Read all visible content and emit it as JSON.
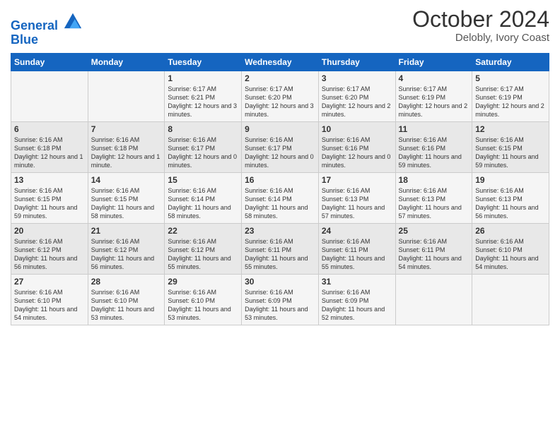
{
  "logo": {
    "line1": "General",
    "line2": "Blue"
  },
  "title": "October 2024",
  "location": "Delobly, Ivory Coast",
  "days_header": [
    "Sunday",
    "Monday",
    "Tuesday",
    "Wednesday",
    "Thursday",
    "Friday",
    "Saturday"
  ],
  "weeks": [
    [
      {
        "day": "",
        "content": ""
      },
      {
        "day": "",
        "content": ""
      },
      {
        "day": "1",
        "content": "Sunrise: 6:17 AM\nSunset: 6:21 PM\nDaylight: 12 hours and 3 minutes."
      },
      {
        "day": "2",
        "content": "Sunrise: 6:17 AM\nSunset: 6:20 PM\nDaylight: 12 hours and 3 minutes."
      },
      {
        "day": "3",
        "content": "Sunrise: 6:17 AM\nSunset: 6:20 PM\nDaylight: 12 hours and 2 minutes."
      },
      {
        "day": "4",
        "content": "Sunrise: 6:17 AM\nSunset: 6:19 PM\nDaylight: 12 hours and 2 minutes."
      },
      {
        "day": "5",
        "content": "Sunrise: 6:17 AM\nSunset: 6:19 PM\nDaylight: 12 hours and 2 minutes."
      }
    ],
    [
      {
        "day": "6",
        "content": "Sunrise: 6:16 AM\nSunset: 6:18 PM\nDaylight: 12 hours and 1 minute."
      },
      {
        "day": "7",
        "content": "Sunrise: 6:16 AM\nSunset: 6:18 PM\nDaylight: 12 hours and 1 minute."
      },
      {
        "day": "8",
        "content": "Sunrise: 6:16 AM\nSunset: 6:17 PM\nDaylight: 12 hours and 0 minutes."
      },
      {
        "day": "9",
        "content": "Sunrise: 6:16 AM\nSunset: 6:17 PM\nDaylight: 12 hours and 0 minutes."
      },
      {
        "day": "10",
        "content": "Sunrise: 6:16 AM\nSunset: 6:16 PM\nDaylight: 12 hours and 0 minutes."
      },
      {
        "day": "11",
        "content": "Sunrise: 6:16 AM\nSunset: 6:16 PM\nDaylight: 11 hours and 59 minutes."
      },
      {
        "day": "12",
        "content": "Sunrise: 6:16 AM\nSunset: 6:15 PM\nDaylight: 11 hours and 59 minutes."
      }
    ],
    [
      {
        "day": "13",
        "content": "Sunrise: 6:16 AM\nSunset: 6:15 PM\nDaylight: 11 hours and 59 minutes."
      },
      {
        "day": "14",
        "content": "Sunrise: 6:16 AM\nSunset: 6:15 PM\nDaylight: 11 hours and 58 minutes."
      },
      {
        "day": "15",
        "content": "Sunrise: 6:16 AM\nSunset: 6:14 PM\nDaylight: 11 hours and 58 minutes."
      },
      {
        "day": "16",
        "content": "Sunrise: 6:16 AM\nSunset: 6:14 PM\nDaylight: 11 hours and 58 minutes."
      },
      {
        "day": "17",
        "content": "Sunrise: 6:16 AM\nSunset: 6:13 PM\nDaylight: 11 hours and 57 minutes."
      },
      {
        "day": "18",
        "content": "Sunrise: 6:16 AM\nSunset: 6:13 PM\nDaylight: 11 hours and 57 minutes."
      },
      {
        "day": "19",
        "content": "Sunrise: 6:16 AM\nSunset: 6:13 PM\nDaylight: 11 hours and 56 minutes."
      }
    ],
    [
      {
        "day": "20",
        "content": "Sunrise: 6:16 AM\nSunset: 6:12 PM\nDaylight: 11 hours and 56 minutes."
      },
      {
        "day": "21",
        "content": "Sunrise: 6:16 AM\nSunset: 6:12 PM\nDaylight: 11 hours and 56 minutes."
      },
      {
        "day": "22",
        "content": "Sunrise: 6:16 AM\nSunset: 6:12 PM\nDaylight: 11 hours and 55 minutes."
      },
      {
        "day": "23",
        "content": "Sunrise: 6:16 AM\nSunset: 6:11 PM\nDaylight: 11 hours and 55 minutes."
      },
      {
        "day": "24",
        "content": "Sunrise: 6:16 AM\nSunset: 6:11 PM\nDaylight: 11 hours and 55 minutes."
      },
      {
        "day": "25",
        "content": "Sunrise: 6:16 AM\nSunset: 6:11 PM\nDaylight: 11 hours and 54 minutes."
      },
      {
        "day": "26",
        "content": "Sunrise: 6:16 AM\nSunset: 6:10 PM\nDaylight: 11 hours and 54 minutes."
      }
    ],
    [
      {
        "day": "27",
        "content": "Sunrise: 6:16 AM\nSunset: 6:10 PM\nDaylight: 11 hours and 54 minutes."
      },
      {
        "day": "28",
        "content": "Sunrise: 6:16 AM\nSunset: 6:10 PM\nDaylight: 11 hours and 53 minutes."
      },
      {
        "day": "29",
        "content": "Sunrise: 6:16 AM\nSunset: 6:10 PM\nDaylight: 11 hours and 53 minutes."
      },
      {
        "day": "30",
        "content": "Sunrise: 6:16 AM\nSunset: 6:09 PM\nDaylight: 11 hours and 53 minutes."
      },
      {
        "day": "31",
        "content": "Sunrise: 6:16 AM\nSunset: 6:09 PM\nDaylight: 11 hours and 52 minutes."
      },
      {
        "day": "",
        "content": ""
      },
      {
        "day": "",
        "content": ""
      }
    ]
  ]
}
